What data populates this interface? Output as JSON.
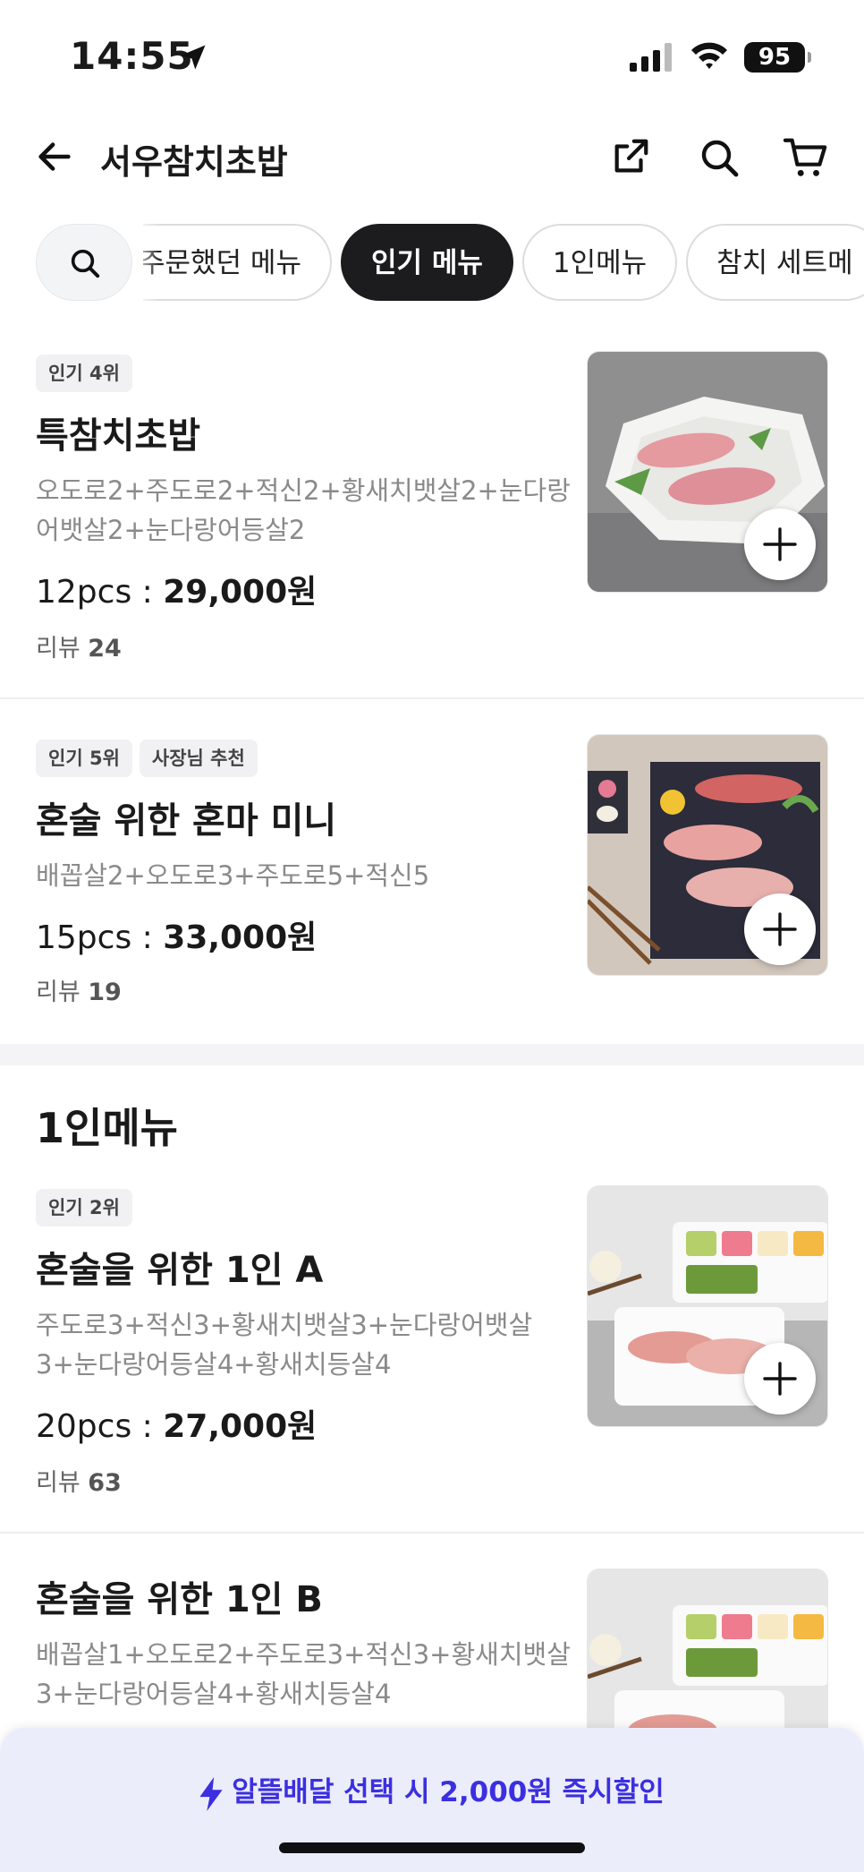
{
  "status_bar": {
    "time": "14:55",
    "battery": "95"
  },
  "header": {
    "title": "서우참치초밥"
  },
  "chips": [
    "주문했던 메뉴",
    "인기 메뉴",
    "1인메뉴",
    "참치 세트메"
  ],
  "items": [
    {
      "badges": [
        "인기 4위"
      ],
      "name": "특참치초밥",
      "desc": "오도로2+주도로2+적신2+황새치뱃살2+눈다랑어뱃살2+눈다랑어등살2",
      "pcs": "12pcs : ",
      "price": "29,000원",
      "review_label": "리뷰 ",
      "review_count": "24"
    },
    {
      "badges": [
        "인기 5위",
        "사장님 추천"
      ],
      "name": "혼술 위한 혼마 미니",
      "desc": "배꼽살2+오도로3+주도로5+적신5",
      "pcs": "15pcs : ",
      "price": "33,000원",
      "review_label": "리뷰 ",
      "review_count": "19"
    },
    {
      "badges": [
        "인기 2위"
      ],
      "name": "혼술을 위한 1인 A",
      "desc": "주도로3+적신3+황새치뱃살3+눈다랑어뱃살3+눈다랑어등살4+황새치등살4",
      "pcs": "20pcs : ",
      "price": "27,000원",
      "review_label": "리뷰 ",
      "review_count": "63"
    },
    {
      "badges": [],
      "name": "혼술을 위한 1인 B",
      "desc": "배꼽살1+오도로2+주도로3+적신3+황새치뱃살3+눈다랑어등살4+황새치등살4"
    }
  ],
  "section_title": "1인메뉴",
  "promo": {
    "text": "알뜰배달 선택 시 2,000원 즉시할인"
  },
  "colors": {
    "accent": "#3b2fe0",
    "chip_active": "#1c1c1e",
    "promo_bg": "#ecedfb"
  }
}
